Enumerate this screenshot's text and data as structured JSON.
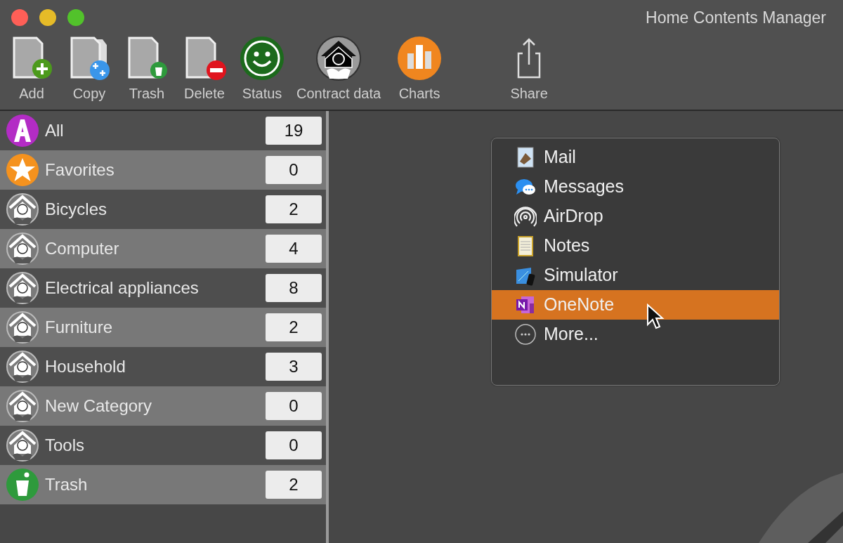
{
  "window": {
    "title": "Home Contents Manager"
  },
  "toolbar": [
    {
      "kind": "add",
      "label": "Add"
    },
    {
      "kind": "copy",
      "label": "Copy"
    },
    {
      "kind": "trash",
      "label": "Trash"
    },
    {
      "kind": "delete",
      "label": "Delete"
    },
    {
      "kind": "status",
      "label": "Status"
    },
    {
      "kind": "contract",
      "label": "Contract data"
    },
    {
      "kind": "charts",
      "label": "Charts"
    },
    {
      "kind": "share",
      "label": "Share"
    }
  ],
  "sidebar": {
    "items": [
      {
        "kind": "all",
        "label": "All",
        "count": "19"
      },
      {
        "kind": "favorites",
        "label": "Favorites",
        "count": "0"
      },
      {
        "kind": "category",
        "label": "Bicycles",
        "count": "2"
      },
      {
        "kind": "category",
        "label": "Computer",
        "count": "4"
      },
      {
        "kind": "category",
        "label": "Electrical appliances",
        "count": "8"
      },
      {
        "kind": "category",
        "label": "Furniture",
        "count": "2"
      },
      {
        "kind": "category",
        "label": "Household",
        "count": "3"
      },
      {
        "kind": "category",
        "label": "New Category",
        "count": "0"
      },
      {
        "kind": "category",
        "label": "Tools",
        "count": "0"
      },
      {
        "kind": "trash",
        "label": "Trash",
        "count": "2"
      }
    ]
  },
  "share_menu": {
    "items": [
      {
        "kind": "mail",
        "label": "Mail",
        "selected": false
      },
      {
        "kind": "messages",
        "label": "Messages",
        "selected": false
      },
      {
        "kind": "airdrop",
        "label": "AirDrop",
        "selected": false
      },
      {
        "kind": "notes",
        "label": "Notes",
        "selected": false
      },
      {
        "kind": "simulator",
        "label": "Simulator",
        "selected": false
      },
      {
        "kind": "onenote",
        "label": "OneNote",
        "selected": true
      },
      {
        "kind": "more",
        "label": "More...",
        "selected": false
      }
    ]
  }
}
